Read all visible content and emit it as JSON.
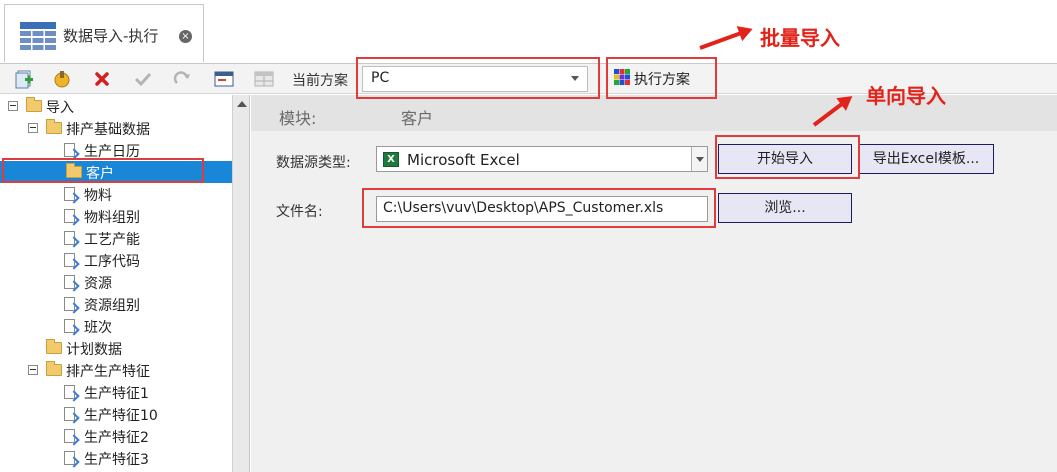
{
  "tab": {
    "title": "数据导入-执行",
    "close_icon": "×"
  },
  "toolbar": {
    "buttons": [
      {
        "name": "add-icon"
      },
      {
        "name": "edit-icon"
      },
      {
        "name": "delete-icon"
      },
      {
        "name": "check-icon"
      },
      {
        "name": "redo-icon"
      },
      {
        "name": "window-icon"
      },
      {
        "name": "table-icon"
      }
    ],
    "scheme_label": "当前方案",
    "scheme_value": "PC",
    "execute_label": "执行方案"
  },
  "tree": {
    "items": [
      {
        "label": "导入",
        "level": 0,
        "kind": "folder",
        "expandable": true
      },
      {
        "label": "排产基础数据",
        "level": 1,
        "kind": "folder",
        "expandable": true
      },
      {
        "label": "生产日历",
        "level": 2,
        "kind": "doc"
      },
      {
        "label": "客户",
        "level": 2,
        "kind": "folder",
        "selected": true
      },
      {
        "label": "物料",
        "level": 2,
        "kind": "doc"
      },
      {
        "label": "物料组别",
        "level": 2,
        "kind": "doc"
      },
      {
        "label": "工艺产能",
        "level": 2,
        "kind": "doc"
      },
      {
        "label": "工序代码",
        "level": 2,
        "kind": "doc"
      },
      {
        "label": "资源",
        "level": 2,
        "kind": "doc"
      },
      {
        "label": "资源组别",
        "level": 2,
        "kind": "doc"
      },
      {
        "label": "班次",
        "level": 2,
        "kind": "doc"
      },
      {
        "label": "计划数据",
        "level": 1,
        "kind": "folder"
      },
      {
        "label": "排产生产特征",
        "level": 1,
        "kind": "folder",
        "expandable": true
      },
      {
        "label": "生产特征1",
        "level": 2,
        "kind": "doc"
      },
      {
        "label": "生产特征10",
        "level": 2,
        "kind": "doc"
      },
      {
        "label": "生产特征2",
        "level": 2,
        "kind": "doc"
      },
      {
        "label": "生产特征3",
        "level": 2,
        "kind": "doc"
      }
    ]
  },
  "main": {
    "module_label": "模块:",
    "module_value": "客户",
    "source_type_label": "数据源类型:",
    "source_type_value": "Microsoft Excel",
    "file_label": "文件名:",
    "file_value": "C:\\Users\\vuv\\Desktop\\APS_Customer.xls",
    "start_import_label": "开始导入",
    "export_template_label": "导出Excel模板...",
    "browse_label": "浏览..."
  },
  "annotations": {
    "batch_import": "批量导入",
    "single_import": "单向导入"
  },
  "colors": {
    "accent_selection": "#1a86d8",
    "annotation_red": "#e2231a",
    "button_border": "#1c1c60"
  }
}
